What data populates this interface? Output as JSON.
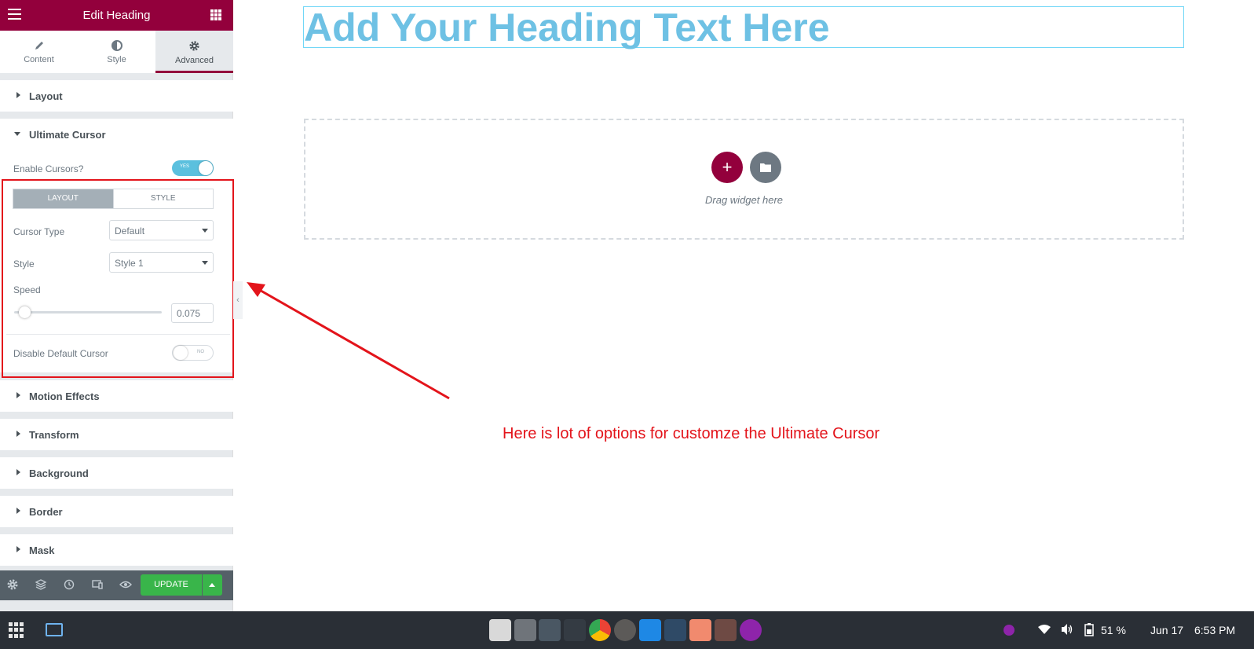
{
  "panel": {
    "title": "Edit Heading",
    "tabs": [
      {
        "label": "Content",
        "icon": "pencil-icon"
      },
      {
        "label": "Style",
        "icon": "half-circle-icon"
      },
      {
        "label": "Advanced",
        "icon": "gear-icon",
        "active": true
      }
    ],
    "sections": {
      "layout": "Layout",
      "ultimate_cursor": "Ultimate Cursor",
      "motion_effects": "Motion Effects",
      "transform": "Transform",
      "background": "Background",
      "border": "Border",
      "mask": "Mask"
    },
    "ultimate_cursor": {
      "enable_label": "Enable Cursors?",
      "enable_toggle_text": "YES",
      "seg_layout": "LAYOUT",
      "seg_style": "STYLE",
      "cursor_type_label": "Cursor Type",
      "cursor_type_value": "Default",
      "style_label": "Style",
      "style_value": "Style 1",
      "speed_label": "Speed",
      "speed_value": "0.075",
      "speed_fraction": 0.07,
      "disable_default_label": "Disable Default Cursor",
      "disable_toggle_text": "NO"
    },
    "footer": {
      "update_label": "UPDATE"
    }
  },
  "canvas": {
    "heading": "Add Your Heading Text Here",
    "drop_zone_text": "Drag widget here",
    "annotation": "Here is lot of options for customze the Ultimate Cursor"
  },
  "taskbar": {
    "battery": "51 %",
    "date": "Jun 17",
    "time": "6:53 PM"
  },
  "colors": {
    "brand": "#93003c",
    "update_green": "#39b54a",
    "heading_blue": "#6ec1e4",
    "annotation_red": "#e3141b",
    "toggle_on": "#5bc0de"
  }
}
